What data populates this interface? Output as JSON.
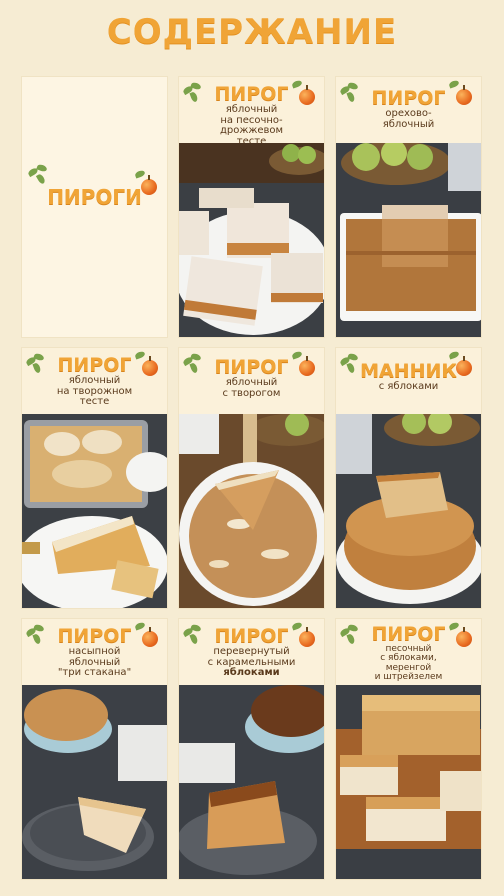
{
  "page": {
    "title": "СОДЕРЖАНИЕ"
  },
  "cards": [
    {
      "main": "ПИРОГИ",
      "sub": []
    },
    {
      "main": "ПИРОГ",
      "sub": [
        "яблочный",
        "на песочно-",
        "дрожжевом",
        "тесте"
      ]
    },
    {
      "main": "ПИРОГ",
      "sub": [
        "орехово-",
        "яблочный"
      ]
    },
    {
      "main": "ПИРОГ",
      "sub": [
        "яблочный",
        "на творожном",
        "тесте"
      ]
    },
    {
      "main": "ПИРОГ",
      "sub": [
        "яблочный",
        "с творогом"
      ]
    },
    {
      "main": "МАННИК",
      "sub": [
        "с яблоками"
      ]
    },
    {
      "main": "ПИРОГ",
      "sub": [
        "насыпной",
        "яблочный",
        "\"три стакана\""
      ]
    },
    {
      "main": "ПИРОГ",
      "sub": [
        "перевернутый",
        "с карамельными",
        "яблоками"
      ]
    },
    {
      "main": "ПИРОГ",
      "sub": [
        "песочный",
        "с яблоками,",
        "меренгой",
        "и штрейзелем"
      ]
    }
  ],
  "icons": {
    "leaf": "leaf-icon",
    "apple": "apple-icon"
  },
  "colors": {
    "accent": "#f0a436",
    "background": "#f6ecd3",
    "card": "#fdf5e3",
    "text": "#5a3a1c"
  }
}
